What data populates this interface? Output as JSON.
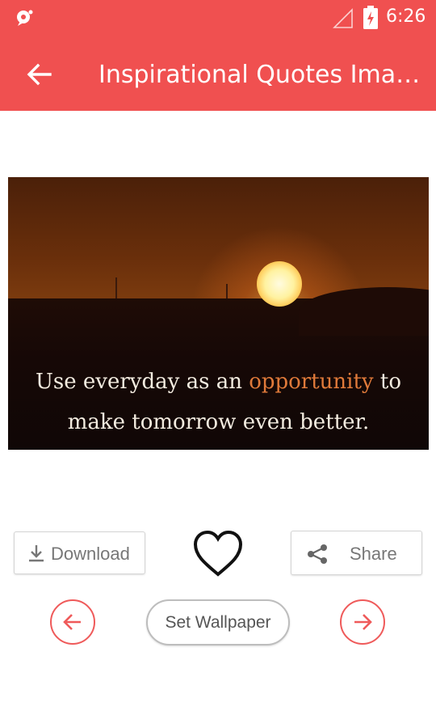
{
  "status_bar": {
    "time": "6:26",
    "app_icon": "notification-app-icon",
    "signal_icon": "signal-icon",
    "battery_icon": "battery-charging-icon"
  },
  "app_bar": {
    "title": "Inspirational Quotes Ima…",
    "back_icon": "arrow-left-icon",
    "color": "#f05050"
  },
  "quote_image": {
    "text_before": "Use everyday as an ",
    "highlight": "opportunity",
    "text_after": " to",
    "line2": "make tomorrow even better."
  },
  "actions": {
    "download_label": "Download",
    "download_icon": "download-icon",
    "favorite_icon": "heart-outline-icon",
    "share_label": "Share",
    "share_icon": "share-icon",
    "set_wallpaper_label": "Set Wallpaper",
    "prev_icon": "arrow-left-circle-icon",
    "next_icon": "arrow-right-circle-icon",
    "accent": "#ef5a5a"
  }
}
